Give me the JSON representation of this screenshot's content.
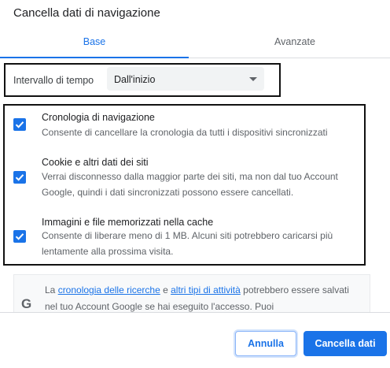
{
  "dialog": {
    "title": "Cancella dati di navigazione"
  },
  "tabs": [
    {
      "label": "Base",
      "selected": true
    },
    {
      "label": "Avanzate",
      "selected": false
    }
  ],
  "time_range": {
    "label": "Intervallo di tempo",
    "selected_value": "Dall'inizio"
  },
  "options": [
    {
      "title": "Cronologia di navigazione",
      "description": "Consente di cancellare la cronologia da tutti i dispositivi sincronizzati",
      "checked": true
    },
    {
      "title": "Cookie e altri dati dei siti",
      "description": "Verrai disconnesso dalla maggior parte dei siti, ma non dal tuo Account Google, quindi i dati sincronizzati possono essere cancellati.",
      "checked": true
    },
    {
      "title": "Immagini e file memorizzati nella cache",
      "description": "Consente di liberare meno di 1 MB. Alcuni siti potrebbero caricarsi più lentamente alla prossima visita.",
      "checked": true
    }
  ],
  "info": {
    "icon": "google-g-icon",
    "text_1": "La ",
    "link_1": "cronologia delle ricerche",
    "text_2": " e ",
    "link_2": "altri tipi di attività",
    "text_3": " potrebbero essere salvati nel tuo Account Google se hai eseguito l'accesso. Puoi"
  },
  "buttons": {
    "cancel": "Annulla",
    "clear": "Cancella dati"
  },
  "colors": {
    "accent": "#1a73e8",
    "annotation_box": "#111111"
  }
}
